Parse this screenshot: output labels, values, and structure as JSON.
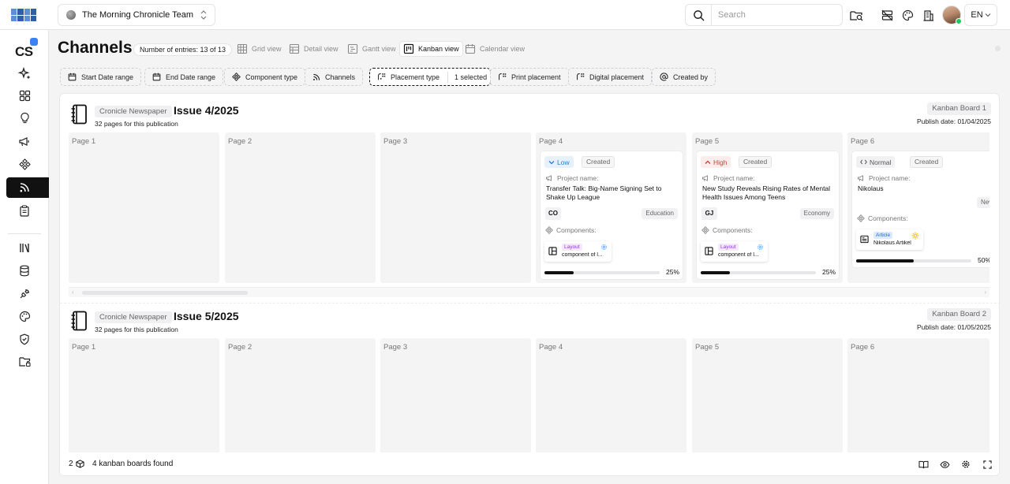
{
  "app": {
    "team_name": "The Morning Chronicle Team",
    "logo_name": "app-logo",
    "brand_initials": "CS"
  },
  "topbar": {
    "search_placeholder": "Search",
    "language": "EN"
  },
  "header": {
    "title": "Channels",
    "entries_label": "Number of entries: 13 of 13",
    "views": [
      {
        "label": "Grid view",
        "active": false
      },
      {
        "label": "Detail view",
        "active": false
      },
      {
        "label": "Gantt view",
        "active": false
      },
      {
        "label": "Kanban view",
        "active": true
      },
      {
        "label": "Calendar view",
        "active": false
      }
    ]
  },
  "filters": [
    {
      "label": "Start Date range"
    },
    {
      "label": "End Date range"
    },
    {
      "label": "Component type"
    },
    {
      "label": "Channels"
    },
    {
      "label": "Placement type",
      "selection": "1 selected",
      "active": true
    },
    {
      "label": "Print placement"
    },
    {
      "label": "Digital placement"
    },
    {
      "label": "Created by"
    }
  ],
  "boards": [
    {
      "publication": "Cronicle Newspaper",
      "issue": "Issue 4/2025",
      "pages_note": "32 pages for this publication",
      "board_name": "Kanban Board 1",
      "publish_date": "Publish date: 01/04/2025",
      "columns": [
        {
          "title": "Page 1",
          "cards": []
        },
        {
          "title": "Page 2",
          "cards": []
        },
        {
          "title": "Page 3",
          "cards": []
        },
        {
          "title": "Page 4",
          "cards": [
            {
              "priority": "Low",
              "status": "Created",
              "project_label": "Project name:",
              "project_name": "Transfer Talk: Big-Name Signing Set to Shake Up League",
              "initials": "CO",
              "category": "Education",
              "components_label": "Components:",
              "component_type": "Layout",
              "component_name": "component of l...",
              "progress": 0.25,
              "progress_label": "25%"
            }
          ]
        },
        {
          "title": "Page 5",
          "cards": [
            {
              "priority": "High",
              "status": "Created",
              "project_label": "Project name:",
              "project_name": "New Study Reveals Rising Rates of Mental Health Issues Among Teens",
              "initials": "GJ",
              "category": "Economy",
              "components_label": "Components:",
              "component_type": "Layout",
              "component_name": "component of l...",
              "progress": 0.25,
              "progress_label": "25%"
            }
          ]
        },
        {
          "title": "Page 6",
          "cards": [
            {
              "priority": "Normal",
              "status": "Created",
              "project_label": "Project name:",
              "project_name": "Nikolaus",
              "category": "News",
              "components_label": "Components:",
              "component_type": "Article",
              "component_name": "Nikolaus Artikel",
              "progress": 0.5,
              "progress_label": "50%"
            }
          ]
        }
      ]
    },
    {
      "publication": "Cronicle Newspaper",
      "issue": "Issue 5/2025",
      "pages_note": "32 pages for this publication",
      "board_name": "Kanban Board 2",
      "publish_date": "Publish date: 01/05/2025",
      "columns": [
        {
          "title": "Page 1"
        },
        {
          "title": "Page 2"
        },
        {
          "title": "Page 3"
        },
        {
          "title": "Page 4"
        },
        {
          "title": "Page 5"
        },
        {
          "title": "Page 6"
        }
      ]
    }
  ],
  "footer": {
    "count": "2",
    "text": "4 kanban boards found"
  }
}
